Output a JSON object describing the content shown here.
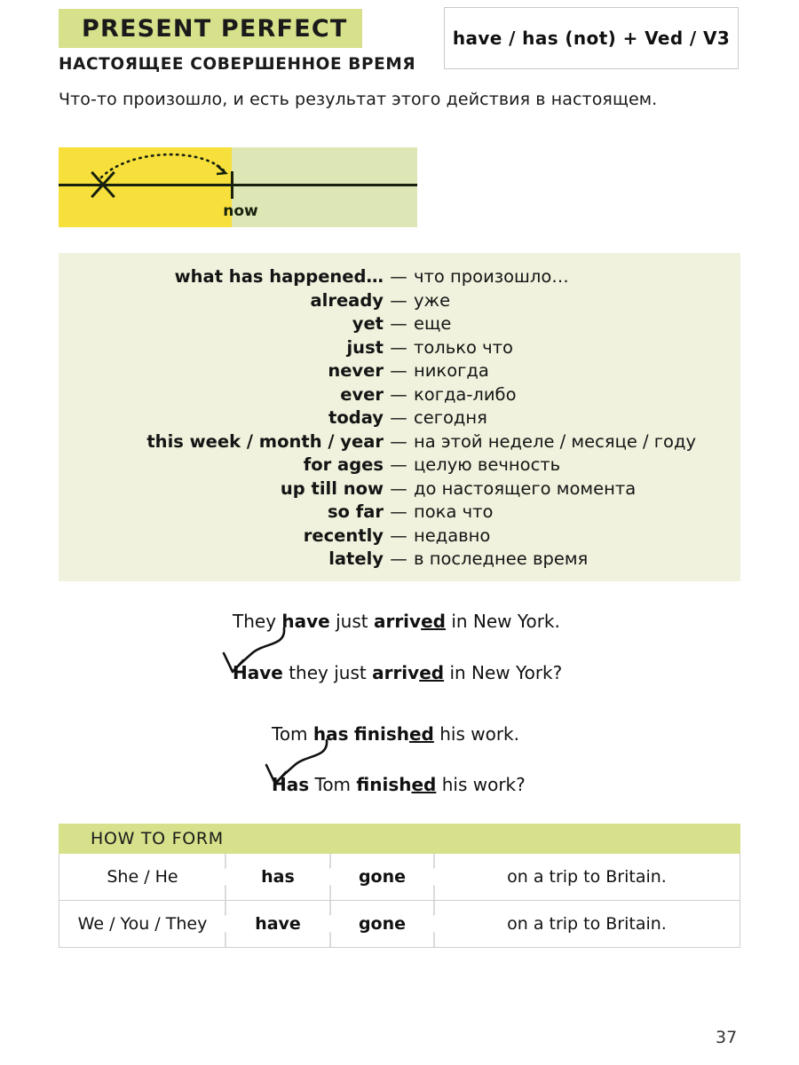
{
  "header": {
    "title": "PRESENT PERFECT",
    "formula": "have / has (not) + Ved / V3",
    "subtitle": "НАСТОЯЩЕЕ СОВЕРШЕННОЕ ВРЕМЯ",
    "intro": "Что-то произошло, и есть результат этого действия в настоящем.",
    "banner_color": "#d7e08a"
  },
  "timeline": {
    "now_label": "now",
    "past_color": "#f7e03c",
    "future_color": "#dde7b5",
    "axis_color": "#17210d",
    "marker": "x-mark",
    "arc": "dotted-arc-arrow"
  },
  "vocabulary": {
    "background_color": "#f0f2dd",
    "separator": "—",
    "items": [
      {
        "en": "what has happened…",
        "ru": "что произошло…"
      },
      {
        "en": "already",
        "ru": "уже"
      },
      {
        "en": "yet",
        "ru": "еще"
      },
      {
        "en": "just",
        "ru": "только что"
      },
      {
        "en": "never",
        "ru": "никогда"
      },
      {
        "en": "ever",
        "ru": "когда-либо"
      },
      {
        "en": "today",
        "ru": "сегодня"
      },
      {
        "en": "this week / month / year",
        "ru": "на этой неделе / месяце / году"
      },
      {
        "en": "for ages",
        "ru": "целую вечность"
      },
      {
        "en": "up till now",
        "ru": "до настоящего момента"
      },
      {
        "en": "so far",
        "ru": "пока что"
      },
      {
        "en": "recently",
        "ru": "недавно"
      },
      {
        "en": "lately",
        "ru": "в последнее время"
      }
    ]
  },
  "examples": [
    {
      "statement": {
        "pre": "They ",
        "aux": "have",
        "mid": " just ",
        "verb_stem": "arriv",
        "verb_end": "ed",
        "post": " in New York."
      },
      "question": {
        "aux": "Have",
        "pre": " they just ",
        "verb_stem": "arriv",
        "verb_end": "ed",
        "post": " in New York?"
      }
    },
    {
      "statement": {
        "pre": "Tom ",
        "aux": "has",
        "mid": " ",
        "verb_stem": "finish",
        "verb_end": "ed",
        "post": " his work."
      },
      "question": {
        "aux": "Has",
        "pre": " Tom ",
        "verb_stem": "finish",
        "verb_end": "ed",
        "post": " his work?"
      }
    }
  ],
  "how_to_form": {
    "heading": "HOW TO FORM",
    "heading_color": "#d7e08a",
    "divider": "puzzle-notch",
    "rows": [
      {
        "subject": "She / He",
        "aux": "has",
        "verb": "gone",
        "rest": "on a trip to Britain."
      },
      {
        "subject": "We / You / They",
        "aux": "have",
        "verb": "gone",
        "rest": "on a trip to Britain."
      }
    ]
  },
  "page_number": "37"
}
